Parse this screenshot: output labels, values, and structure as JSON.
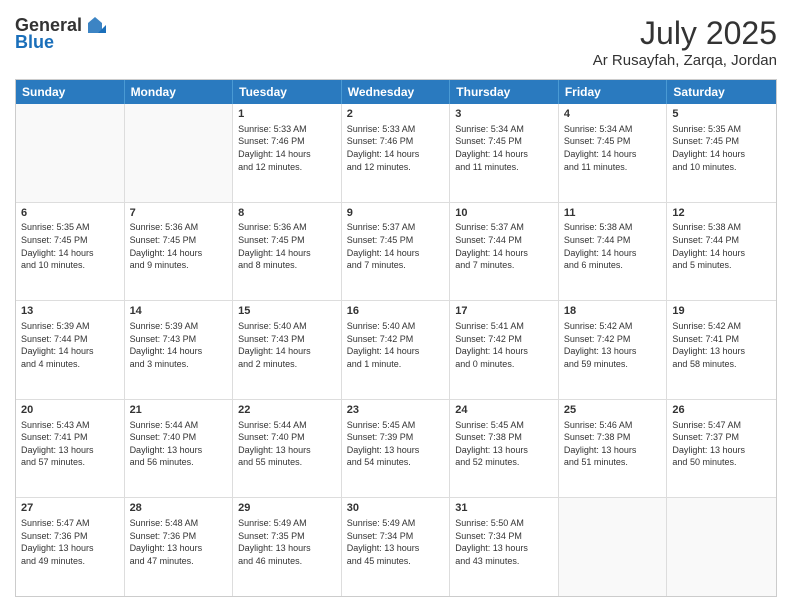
{
  "header": {
    "logo_line1": "General",
    "logo_line2": "Blue",
    "month": "July 2025",
    "location": "Ar Rusayfah, Zarqa, Jordan"
  },
  "weekdays": [
    "Sunday",
    "Monday",
    "Tuesday",
    "Wednesday",
    "Thursday",
    "Friday",
    "Saturday"
  ],
  "weeks": [
    [
      {
        "day": "",
        "text": "",
        "empty": true
      },
      {
        "day": "",
        "text": "",
        "empty": true
      },
      {
        "day": "1",
        "text": "Sunrise: 5:33 AM\nSunset: 7:46 PM\nDaylight: 14 hours\nand 12 minutes.",
        "empty": false
      },
      {
        "day": "2",
        "text": "Sunrise: 5:33 AM\nSunset: 7:46 PM\nDaylight: 14 hours\nand 12 minutes.",
        "empty": false
      },
      {
        "day": "3",
        "text": "Sunrise: 5:34 AM\nSunset: 7:45 PM\nDaylight: 14 hours\nand 11 minutes.",
        "empty": false
      },
      {
        "day": "4",
        "text": "Sunrise: 5:34 AM\nSunset: 7:45 PM\nDaylight: 14 hours\nand 11 minutes.",
        "empty": false
      },
      {
        "day": "5",
        "text": "Sunrise: 5:35 AM\nSunset: 7:45 PM\nDaylight: 14 hours\nand 10 minutes.",
        "empty": false
      }
    ],
    [
      {
        "day": "6",
        "text": "Sunrise: 5:35 AM\nSunset: 7:45 PM\nDaylight: 14 hours\nand 10 minutes.",
        "empty": false
      },
      {
        "day": "7",
        "text": "Sunrise: 5:36 AM\nSunset: 7:45 PM\nDaylight: 14 hours\nand 9 minutes.",
        "empty": false
      },
      {
        "day": "8",
        "text": "Sunrise: 5:36 AM\nSunset: 7:45 PM\nDaylight: 14 hours\nand 8 minutes.",
        "empty": false
      },
      {
        "day": "9",
        "text": "Sunrise: 5:37 AM\nSunset: 7:45 PM\nDaylight: 14 hours\nand 7 minutes.",
        "empty": false
      },
      {
        "day": "10",
        "text": "Sunrise: 5:37 AM\nSunset: 7:44 PM\nDaylight: 14 hours\nand 7 minutes.",
        "empty": false
      },
      {
        "day": "11",
        "text": "Sunrise: 5:38 AM\nSunset: 7:44 PM\nDaylight: 14 hours\nand 6 minutes.",
        "empty": false
      },
      {
        "day": "12",
        "text": "Sunrise: 5:38 AM\nSunset: 7:44 PM\nDaylight: 14 hours\nand 5 minutes.",
        "empty": false
      }
    ],
    [
      {
        "day": "13",
        "text": "Sunrise: 5:39 AM\nSunset: 7:44 PM\nDaylight: 14 hours\nand 4 minutes.",
        "empty": false
      },
      {
        "day": "14",
        "text": "Sunrise: 5:39 AM\nSunset: 7:43 PM\nDaylight: 14 hours\nand 3 minutes.",
        "empty": false
      },
      {
        "day": "15",
        "text": "Sunrise: 5:40 AM\nSunset: 7:43 PM\nDaylight: 14 hours\nand 2 minutes.",
        "empty": false
      },
      {
        "day": "16",
        "text": "Sunrise: 5:40 AM\nSunset: 7:42 PM\nDaylight: 14 hours\nand 1 minute.",
        "empty": false
      },
      {
        "day": "17",
        "text": "Sunrise: 5:41 AM\nSunset: 7:42 PM\nDaylight: 14 hours\nand 0 minutes.",
        "empty": false
      },
      {
        "day": "18",
        "text": "Sunrise: 5:42 AM\nSunset: 7:42 PM\nDaylight: 13 hours\nand 59 minutes.",
        "empty": false
      },
      {
        "day": "19",
        "text": "Sunrise: 5:42 AM\nSunset: 7:41 PM\nDaylight: 13 hours\nand 58 minutes.",
        "empty": false
      }
    ],
    [
      {
        "day": "20",
        "text": "Sunrise: 5:43 AM\nSunset: 7:41 PM\nDaylight: 13 hours\nand 57 minutes.",
        "empty": false
      },
      {
        "day": "21",
        "text": "Sunrise: 5:44 AM\nSunset: 7:40 PM\nDaylight: 13 hours\nand 56 minutes.",
        "empty": false
      },
      {
        "day": "22",
        "text": "Sunrise: 5:44 AM\nSunset: 7:40 PM\nDaylight: 13 hours\nand 55 minutes.",
        "empty": false
      },
      {
        "day": "23",
        "text": "Sunrise: 5:45 AM\nSunset: 7:39 PM\nDaylight: 13 hours\nand 54 minutes.",
        "empty": false
      },
      {
        "day": "24",
        "text": "Sunrise: 5:45 AM\nSunset: 7:38 PM\nDaylight: 13 hours\nand 52 minutes.",
        "empty": false
      },
      {
        "day": "25",
        "text": "Sunrise: 5:46 AM\nSunset: 7:38 PM\nDaylight: 13 hours\nand 51 minutes.",
        "empty": false
      },
      {
        "day": "26",
        "text": "Sunrise: 5:47 AM\nSunset: 7:37 PM\nDaylight: 13 hours\nand 50 minutes.",
        "empty": false
      }
    ],
    [
      {
        "day": "27",
        "text": "Sunrise: 5:47 AM\nSunset: 7:36 PM\nDaylight: 13 hours\nand 49 minutes.",
        "empty": false
      },
      {
        "day": "28",
        "text": "Sunrise: 5:48 AM\nSunset: 7:36 PM\nDaylight: 13 hours\nand 47 minutes.",
        "empty": false
      },
      {
        "day": "29",
        "text": "Sunrise: 5:49 AM\nSunset: 7:35 PM\nDaylight: 13 hours\nand 46 minutes.",
        "empty": false
      },
      {
        "day": "30",
        "text": "Sunrise: 5:49 AM\nSunset: 7:34 PM\nDaylight: 13 hours\nand 45 minutes.",
        "empty": false
      },
      {
        "day": "31",
        "text": "Sunrise: 5:50 AM\nSunset: 7:34 PM\nDaylight: 13 hours\nand 43 minutes.",
        "empty": false
      },
      {
        "day": "",
        "text": "",
        "empty": true
      },
      {
        "day": "",
        "text": "",
        "empty": true
      }
    ]
  ]
}
